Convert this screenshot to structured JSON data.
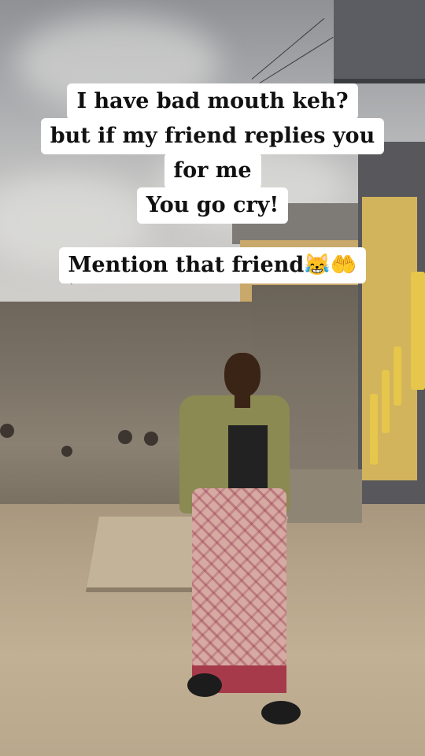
{
  "caption": {
    "lines": [
      "I have bad mouth keh?",
      "but if my friend replies you",
      "for me",
      "You go cry!",
      "Mention that friend😹🤲"
    ]
  }
}
